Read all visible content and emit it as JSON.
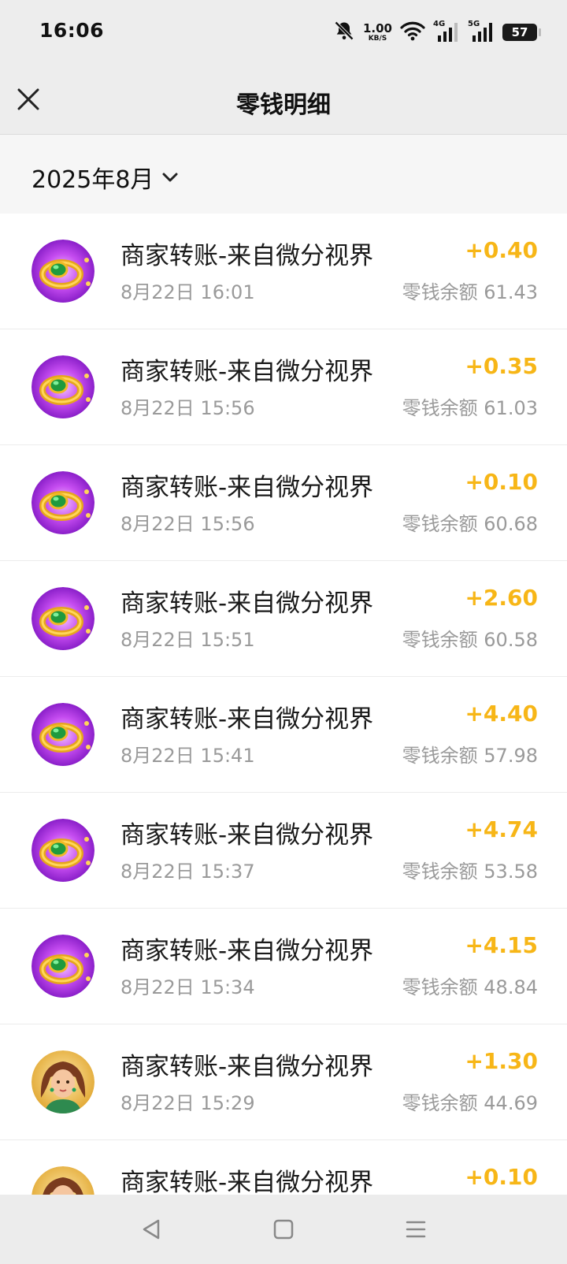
{
  "status_bar": {
    "time": "16:06",
    "net_speed_value": "1.00",
    "net_speed_unit": "KB/S",
    "signal_1_gen": "4G",
    "signal_2_gen": "5G",
    "battery": "57",
    "icons": [
      "bell-muted-icon",
      "wifi-icon",
      "signal-4g-icon",
      "signal-5g-icon",
      "battery-icon"
    ]
  },
  "header": {
    "title": "零钱明细",
    "close_icon": "close-icon"
  },
  "filter": {
    "month": "2025年8月",
    "dropdown_icon": "chevron-down-icon"
  },
  "colors": {
    "amount": "#f7b617",
    "muted_text": "#9a9a9a",
    "header_bg": "#ededed"
  },
  "transactions": [
    {
      "avatar": "ring-icon",
      "title": "商家转账-来自微分视界",
      "time": "8月22日 16:01",
      "amount": "+0.40",
      "balance": "零钱余额 61.43"
    },
    {
      "avatar": "ring-icon",
      "title": "商家转账-来自微分视界",
      "time": "8月22日 15:56",
      "amount": "+0.35",
      "balance": "零钱余额 61.03"
    },
    {
      "avatar": "ring-icon",
      "title": "商家转账-来自微分视界",
      "time": "8月22日 15:56",
      "amount": "+0.10",
      "balance": "零钱余额 60.68"
    },
    {
      "avatar": "ring-icon",
      "title": "商家转账-来自微分视界",
      "time": "8月22日 15:51",
      "amount": "+2.60",
      "balance": "零钱余额 60.58"
    },
    {
      "avatar": "ring-icon",
      "title": "商家转账-来自微分视界",
      "time": "8月22日 15:41",
      "amount": "+4.40",
      "balance": "零钱余额 57.98"
    },
    {
      "avatar": "ring-icon",
      "title": "商家转账-来自微分视界",
      "time": "8月22日 15:37",
      "amount": "+4.74",
      "balance": "零钱余额 53.58"
    },
    {
      "avatar": "ring-icon",
      "title": "商家转账-来自微分视界",
      "time": "8月22日 15:34",
      "amount": "+4.15",
      "balance": "零钱余额 48.84"
    },
    {
      "avatar": "character-avatar-icon",
      "title": "商家转账-来自微分视界",
      "time": "8月22日 15:29",
      "amount": "+1.30",
      "balance": "零钱余额 44.69"
    },
    {
      "avatar": "character-avatar-icon",
      "title": "商家转账-来自微分视界",
      "time": "",
      "amount": "+0.10",
      "balance": ""
    }
  ],
  "system_nav": {
    "icons": [
      "back-triangle-icon",
      "home-square-icon",
      "menu-lines-icon"
    ]
  }
}
